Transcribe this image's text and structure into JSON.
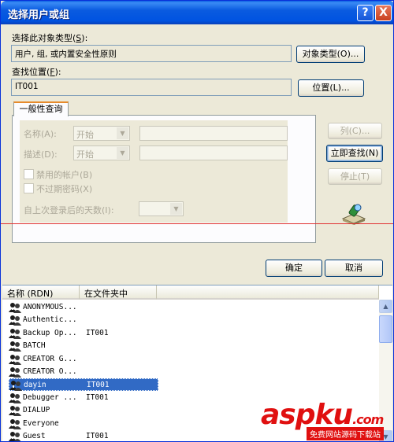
{
  "window": {
    "title": "选择用户或组"
  },
  "title_buttons": {
    "help": "?",
    "close": "X"
  },
  "object_types": {
    "label_pre": "选择此对象类型(",
    "label_key": "S",
    "label_post": "):",
    "value": "用户, 组, 或内置安全性原则",
    "button": "对象类型(O)..."
  },
  "location": {
    "label_pre": "查找位置(",
    "label_key": "F",
    "label_post": "):",
    "value": "IT001",
    "button": "位置(L)..."
  },
  "tab": {
    "label": "一般性查询"
  },
  "query": {
    "name_label": "名称(A):",
    "name_mode": "开始",
    "desc_label": "描述(D):",
    "desc_mode": "开始",
    "disabled_accounts": "禁用的帐户(B)",
    "non_expiring": "不过期密码(X)",
    "days_label": "自上次登录后的天数(I):"
  },
  "side_buttons": {
    "columns": "列(C)...",
    "find_now": "立即查找(N)",
    "stop": "停止(T)"
  },
  "actions": {
    "ok": "确定",
    "cancel": "取消"
  },
  "results": {
    "columns": [
      "名称 (RDN)",
      "在文件夹中"
    ],
    "rows": [
      {
        "name": "ANONYMOUS...",
        "folder": ""
      },
      {
        "name": "Authentic...",
        "folder": ""
      },
      {
        "name": "Backup Op...",
        "folder": "IT001"
      },
      {
        "name": "BATCH",
        "folder": ""
      },
      {
        "name": "CREATOR G...",
        "folder": ""
      },
      {
        "name": "CREATOR O...",
        "folder": ""
      },
      {
        "name": "dayin",
        "folder": "IT001",
        "selected": true
      },
      {
        "name": "Debugger ...",
        "folder": "IT001"
      },
      {
        "name": "DIALUP",
        "folder": ""
      },
      {
        "name": "Everyone",
        "folder": ""
      },
      {
        "name": "Guest",
        "folder": "IT001"
      }
    ]
  },
  "watermark": {
    "main": "aspku",
    "suffix": ".com",
    "sub": "免费网站源码下载站"
  },
  "colors": {
    "accent": "#0a5be0",
    "selection": "#316ac5",
    "watermark": "#e01010"
  }
}
